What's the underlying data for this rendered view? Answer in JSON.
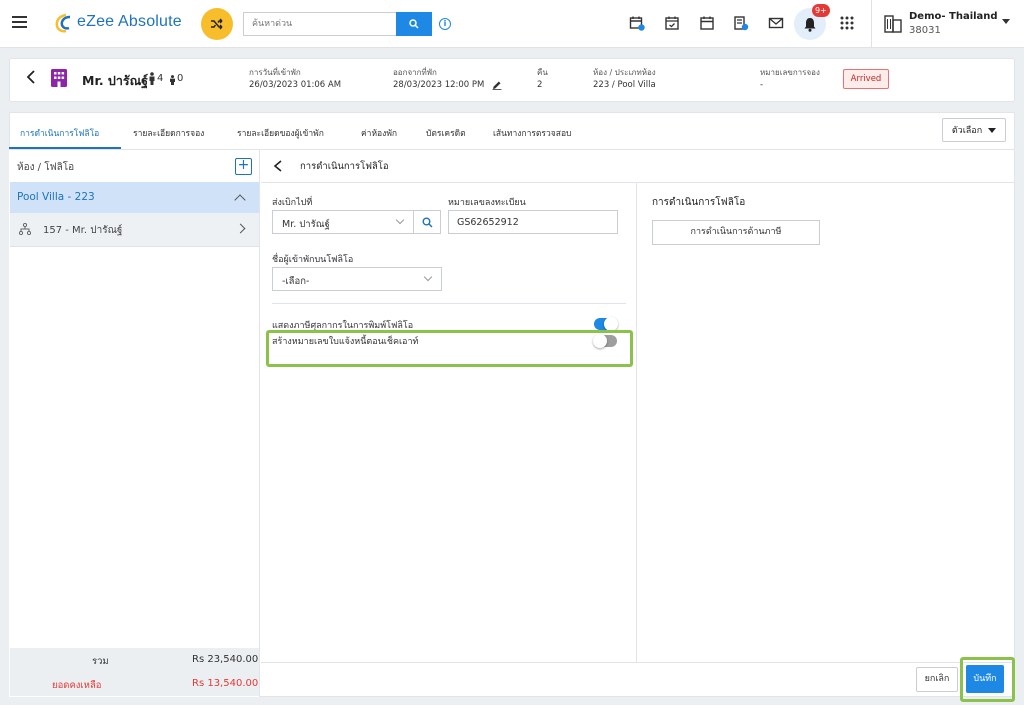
{
  "topbar": {
    "app_name": "eZee Absolute",
    "search_placeholder": "ค้นหาด่วน",
    "notification_badge": "9+",
    "property_name": "Demo- Thailand",
    "property_code": "38031"
  },
  "guest": {
    "name": "Mr. ปารัณฐ์",
    "adults": "4",
    "children": "0",
    "arrival_label": "การวันที่เข้าพัก",
    "arrival_value": "26/03/2023 01:06 AM",
    "departure_label": "ออกจากที่พัก",
    "departure_value": "28/03/2023 12:00 PM",
    "nights_label": "คืน",
    "nights_value": "2",
    "room_label": "ห้อง / ประเภทห้อง",
    "room_value": "223 / Pool Villa",
    "reservation_label": "หมายเลขการจอง",
    "reservation_value": "-",
    "status": "Arrived"
  },
  "tabs": [
    {
      "label": "การดำเนินการโฟลิโอ"
    },
    {
      "label": "รายละเอียดการจอง"
    },
    {
      "label": "รายละเอียดของผู้เข้าพัก"
    },
    {
      "label": "ค่าห้องพัก"
    },
    {
      "label": "บัตรเครดิต"
    },
    {
      "label": "เส้นทางการตรวจสอบ"
    }
  ],
  "options_label": "ตัวเลือก",
  "left": {
    "heading": "ห้อง / โฟลิโอ",
    "room_item": "Pool Villa - 223",
    "guest_item": "157 - Mr. ปารัณฐ์",
    "total_label": "รวม",
    "total_value": "Rs 23,540.00",
    "balance_label": "ยอดคงเหลือ",
    "balance_value": "Rs 13,540.00"
  },
  "content": {
    "title": "การดำเนินการโฟลิโอ",
    "bill_to_label": "ส่งเบิกไปที่",
    "bill_to_value": "Mr. ปารัณฐ์",
    "registration_label": "หมายเลขลงทะเบียน",
    "registration_value": "GS62652912",
    "guest_on_folio_label": "ชื่อผู้เข้าพักบนโฟลิโอ",
    "guest_on_folio_value": "-เลือก-",
    "toggle1_label": "แสดงภาษีศุลกากรในการพิมพ์โฟลิโอ",
    "toggle1_on": true,
    "toggle2_label": "สร้างหมายเลขใบแจ้งหนี้ตอนเช็คเอาท์",
    "toggle2_on": false,
    "right_title": "การดำเนินการโฟลิโอ",
    "tax_button": "การดำเนินการด้านภาษี"
  },
  "footer": {
    "cancel_label": "ยกเลิก",
    "save_label": "บันทึก"
  },
  "colors": {
    "accent": "#1e88e5",
    "brand": "#1e73be",
    "highlight": "#8bc34a",
    "arrived": "#c62828"
  }
}
